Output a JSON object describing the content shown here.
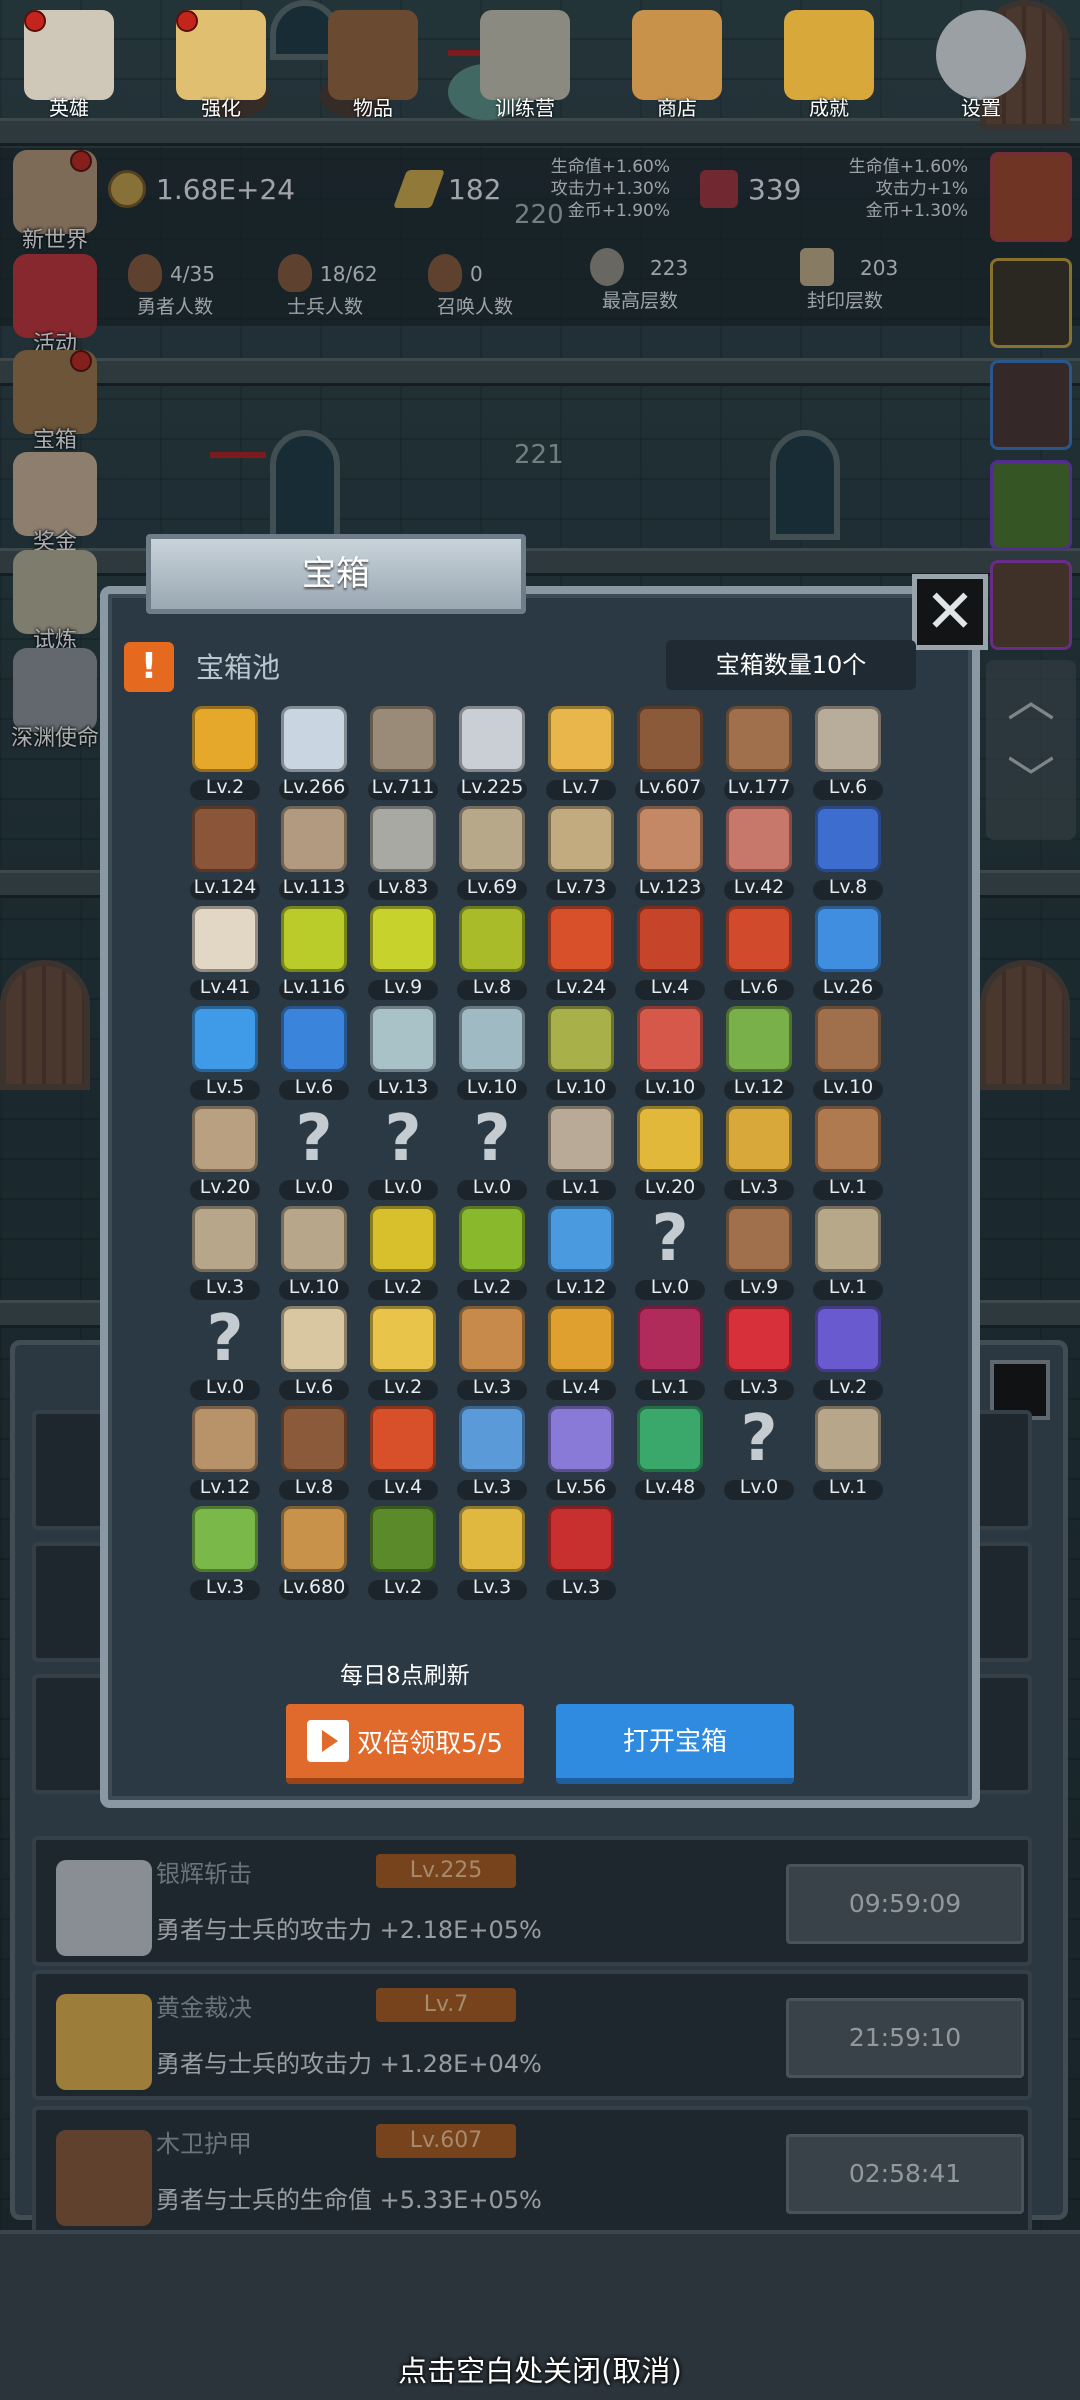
{
  "top_resources": {
    "gold": "1.68E+24",
    "gold_bars": "182",
    "gems": "339",
    "buffs_left": [
      "生命值+1.60%",
      "攻击力+1.30%",
      "金币+1.90%"
    ],
    "buffs_right": [
      "生命值+1.60%",
      "攻击力+1%",
      "金币+1.30%"
    ]
  },
  "stats": [
    {
      "value": "4/35",
      "label": "勇者人数"
    },
    {
      "value": "18/62",
      "label": "士兵人数"
    },
    {
      "value": "0",
      "label": "召唤人数"
    },
    {
      "value": "223",
      "label": "最高层数"
    },
    {
      "value": "203",
      "label": "封印层数"
    }
  ],
  "floors": [
    "220",
    "221"
  ],
  "side_menu": [
    {
      "label": "新世界",
      "icon": "map-icon",
      "color": "#b89a7a",
      "badge": true
    },
    {
      "label": "活动",
      "icon": "heart-icon",
      "color": "#c8343a",
      "badge": false
    },
    {
      "label": "宝箱",
      "icon": "chest-icon",
      "color": "#a0784a",
      "badge": true
    },
    {
      "label": "奖金",
      "icon": "envelope-icon",
      "color": "#d2b79c",
      "badge": false
    },
    {
      "label": "试炼",
      "icon": "feather-icon",
      "color": "#bbb49a",
      "badge": false
    },
    {
      "label": "深渊使命",
      "icon": "orb-icon",
      "color": "#8f969b",
      "badge": false
    }
  ],
  "modal": {
    "title": "宝箱",
    "pool_title": "宝箱池",
    "chest_count": "宝箱数量10个",
    "refresh_note": "每日8点刷新",
    "double_claim": "双倍领取5/5",
    "open_chest": "打开宝箱",
    "items": [
      {
        "lv": "Lv.2",
        "icon": "crown-icon",
        "color": "#e6a82a"
      },
      {
        "lv": "Lv.266",
        "icon": "diamond-icon",
        "color": "#c9d6e2"
      },
      {
        "lv": "Lv.711",
        "icon": "sword-icon",
        "color": "#9a8a78"
      },
      {
        "lv": "Lv.225",
        "icon": "silver-sword-icon",
        "color": "#c9cfd4"
      },
      {
        "lv": "Lv.7",
        "icon": "gold-sword-icon",
        "color": "#e8b64a"
      },
      {
        "lv": "Lv.607",
        "icon": "wood-armor-icon",
        "color": "#8b5a3a"
      },
      {
        "lv": "Lv.177",
        "icon": "leather-armor-icon",
        "color": "#a0704c"
      },
      {
        "lv": "Lv.6",
        "icon": "iron-armor-icon",
        "color": "#b8ad9a"
      },
      {
        "lv": "Lv.124",
        "icon": "leather-helmet-icon",
        "color": "#8a5538"
      },
      {
        "lv": "Lv.113",
        "icon": "dagger-icon",
        "color": "#b29a80"
      },
      {
        "lv": "Lv.83",
        "icon": "knight-helmet-icon",
        "color": "#a9a9a4"
      },
      {
        "lv": "Lv.69",
        "icon": "hammer-icon",
        "color": "#b8a88a"
      },
      {
        "lv": "Lv.73",
        "icon": "great-helmet-icon",
        "color": "#c2ab7e"
      },
      {
        "lv": "Lv.123",
        "icon": "meat-icon",
        "color": "#c48866"
      },
      {
        "lv": "Lv.42",
        "icon": "steak-icon",
        "color": "#c8786a"
      },
      {
        "lv": "Lv.8",
        "icon": "pouch-icon",
        "color": "#3d6ecf"
      },
      {
        "lv": "Lv.41",
        "icon": "rice-bowl-icon",
        "color": "#e2d6c4"
      },
      {
        "lv": "Lv.116",
        "icon": "yellow-potion-icon",
        "color": "#b9cc2a"
      },
      {
        "lv": "Lv.9",
        "icon": "yellow-potion-icon",
        "color": "#c8d22c"
      },
      {
        "lv": "Lv.8",
        "icon": "yellow-potion-icon",
        "color": "#a9bb28"
      },
      {
        "lv": "Lv.24",
        "icon": "red-potion-icon",
        "color": "#d8502a"
      },
      {
        "lv": "Lv.4",
        "icon": "red-potion-icon",
        "color": "#c6442a"
      },
      {
        "lv": "Lv.6",
        "icon": "red-potion-icon",
        "color": "#d14a2c"
      },
      {
        "lv": "Lv.26",
        "icon": "blue-potion-icon",
        "color": "#3f8ee0"
      },
      {
        "lv": "Lv.5",
        "icon": "blue-flask-icon",
        "color": "#3f9ae8"
      },
      {
        "lv": "Lv.6",
        "icon": "blue-flask-icon",
        "color": "#3b84dc"
      },
      {
        "lv": "Lv.13",
        "icon": "empty-bottle-icon",
        "color": "#a9c2c8"
      },
      {
        "lv": "Lv.10",
        "icon": "empty-bottle-icon",
        "color": "#9fbac2"
      },
      {
        "lv": "Lv.10",
        "icon": "green-bottle-icon",
        "color": "#a8b04a"
      },
      {
        "lv": "Lv.10",
        "icon": "red-bottle-icon",
        "color": "#d5584a"
      },
      {
        "lv": "Lv.12",
        "icon": "winged-boots-icon",
        "color": "#7ab04a"
      },
      {
        "lv": "Lv.10",
        "icon": "boot-icon",
        "color": "#a0704c"
      },
      {
        "lv": "Lv.20",
        "icon": "shoe-icon",
        "color": "#b8a080"
      },
      {
        "lv": "Lv.0",
        "icon": "unknown-icon",
        "color": "#c5ccd1"
      },
      {
        "lv": "Lv.0",
        "icon": "unknown-icon",
        "color": "#c5ccd1"
      },
      {
        "lv": "Lv.0",
        "icon": "unknown-icon",
        "color": "#c5ccd1"
      },
      {
        "lv": "Lv.1",
        "icon": "short-sword-icon",
        "color": "#b8aa96"
      },
      {
        "lv": "Lv.20",
        "icon": "torch-icon",
        "color": "#e2b83a"
      },
      {
        "lv": "Lv.3",
        "icon": "torch-icon",
        "color": "#d8a83a"
      },
      {
        "lv": "Lv.1",
        "icon": "mushroom-icon",
        "color": "#b07a50"
      },
      {
        "lv": "Lv.3",
        "icon": "pickaxe-icon",
        "color": "#b8a68a"
      },
      {
        "lv": "Lv.10",
        "icon": "staff-icon",
        "color": "#b8a68a"
      },
      {
        "lv": "Lv.2",
        "icon": "lemon-icon",
        "color": "#d8c02c"
      },
      {
        "lv": "Lv.2",
        "icon": "lime-icon",
        "color": "#8ab82c"
      },
      {
        "lv": "Lv.12",
        "icon": "ice-wand-icon",
        "color": "#4a9ae0"
      },
      {
        "lv": "Lv.0",
        "icon": "unknown-icon",
        "color": "#c5ccd1"
      },
      {
        "lv": "Lv.9",
        "icon": "backpack-icon",
        "color": "#a0704c"
      },
      {
        "lv": "Lv.1",
        "icon": "shovel-icon",
        "color": "#b8a88a"
      },
      {
        "lv": "Lv.0",
        "icon": "unknown-icon",
        "color": "#c5ccd1"
      },
      {
        "lv": "Lv.6",
        "icon": "club-icon",
        "color": "#d8c7a0"
      },
      {
        "lv": "Lv.2",
        "icon": "cheese-icon",
        "color": "#e8c44a"
      },
      {
        "lv": "Lv.3",
        "icon": "pie-icon",
        "color": "#c88a4a"
      },
      {
        "lv": "Lv.4",
        "icon": "honey-jar-icon",
        "color": "#e0a030"
      },
      {
        "lv": "Lv.1",
        "icon": "crystal-icon",
        "color": "#b02a5a"
      },
      {
        "lv": "Lv.3",
        "icon": "red-orb-icon",
        "color": "#d8303a"
      },
      {
        "lv": "Lv.2",
        "icon": "magic-cube-icon",
        "color": "#6a5ad0"
      },
      {
        "lv": "Lv.12",
        "icon": "bow-icon",
        "color": "#b8936a"
      },
      {
        "lv": "Lv.8",
        "icon": "quiver-icon",
        "color": "#8b5a3a"
      },
      {
        "lv": "Lv.4",
        "icon": "flame-totem-icon",
        "color": "#d8502a"
      },
      {
        "lv": "Lv.3",
        "icon": "rune-stone-icon",
        "color": "#5a9ad8"
      },
      {
        "lv": "Lv.56",
        "icon": "tentacle-icon",
        "color": "#8a7ad8"
      },
      {
        "lv": "Lv.48",
        "icon": "emblem-icon",
        "color": "#3aa86a"
      },
      {
        "lv": "Lv.0",
        "icon": "unknown-icon",
        "color": "#c5ccd1"
      },
      {
        "lv": "Lv.1",
        "icon": "arrow-icon",
        "color": "#b8a68a"
      },
      {
        "lv": "Lv.3",
        "icon": "green-wand-icon",
        "color": "#7ab84a"
      },
      {
        "lv": "Lv.680",
        "icon": "beer-mug-icon",
        "color": "#c8924a"
      },
      {
        "lv": "Lv.2",
        "icon": "vine-icon",
        "color": "#5a8a2a"
      },
      {
        "lv": "Lv.3",
        "icon": "gold-pickaxe-icon",
        "color": "#e0b840"
      },
      {
        "lv": "Lv.3",
        "icon": "red-book-icon",
        "color": "#c83030"
      }
    ]
  },
  "skills": [
    {
      "name": "银辉斩击",
      "lv": "Lv.225",
      "desc": "勇者与士兵的攻击力 +2.18E+05%",
      "time": "09:59:09",
      "color": "#c9cfd4"
    },
    {
      "name": "黄金裁决",
      "lv": "Lv.7",
      "desc": "勇者与士兵的攻击力 +1.28E+04%",
      "time": "21:59:10",
      "color": "#e8b64a"
    },
    {
      "name": "木卫护甲",
      "lv": "Lv.607",
      "desc": "勇者与士兵的生命值 +5.33E+05%",
      "time": "02:58:41",
      "color": "#8b5a3a"
    }
  ],
  "bottom_nav": [
    {
      "label": "英雄",
      "icon": "skull-icon",
      "color": "#cfc7b8",
      "badge": true
    },
    {
      "label": "强化",
      "icon": "candle-icon",
      "color": "#e0c070",
      "badge": true
    },
    {
      "label": "物品",
      "icon": "book-icon",
      "color": "#6a4a30",
      "badge": false
    },
    {
      "label": "训练营",
      "icon": "lantern-icon",
      "color": "#8a8a80",
      "badge": false
    },
    {
      "label": "商店",
      "icon": "beer-mug-icon",
      "color": "#c8924a",
      "badge": false
    },
    {
      "label": "成就",
      "icon": "key-icon",
      "color": "#d8a83a",
      "badge": false
    },
    {
      "label": "设置",
      "icon": "gear-icon",
      "color": "#9aa0a4",
      "badge": false
    }
  ],
  "close_hint": "点击空白处关闭(取消)"
}
